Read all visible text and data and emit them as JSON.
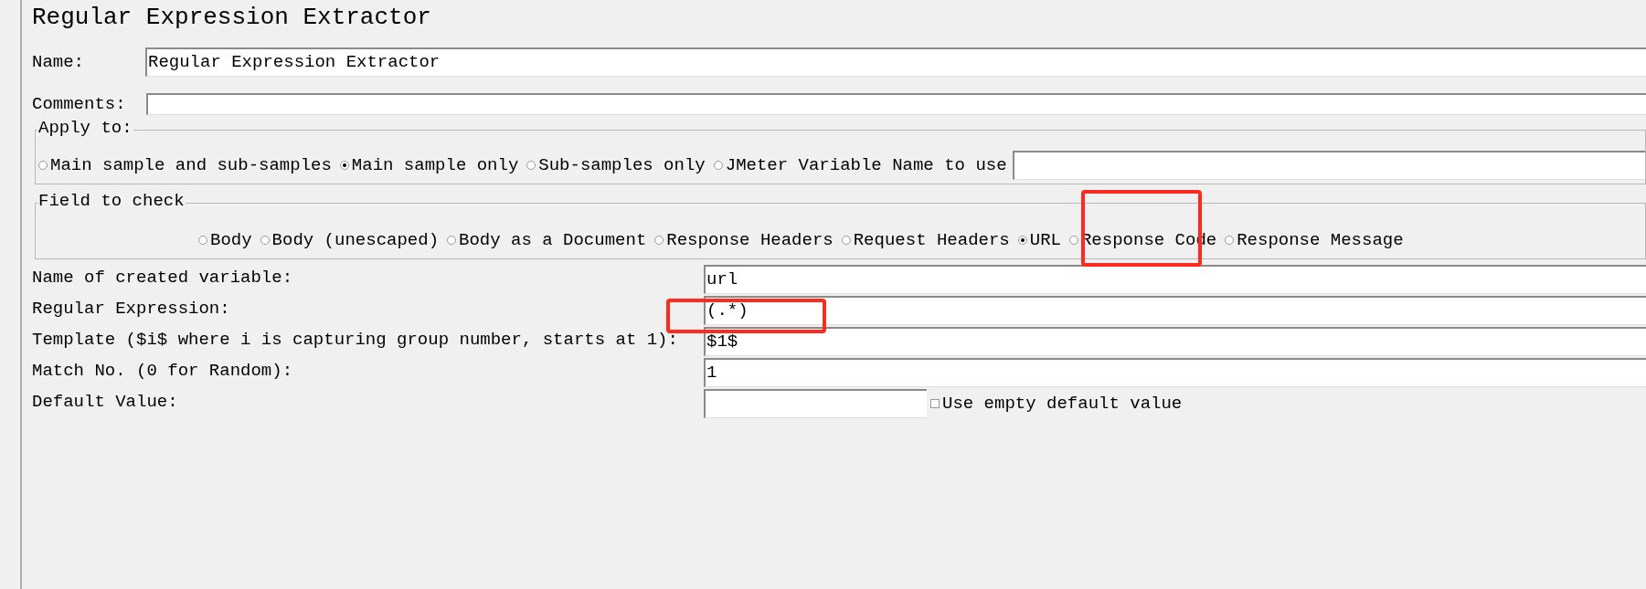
{
  "panel": {
    "title": "Regular Expression Extractor"
  },
  "name": {
    "label": "Name:",
    "value": "Regular Expression Extractor"
  },
  "comments": {
    "label": "Comments:"
  },
  "apply_to": {
    "legend": "Apply to:",
    "options": [
      {
        "label": "Main sample and sub-samples",
        "selected": false
      },
      {
        "label": "Main sample only",
        "selected": true
      },
      {
        "label": "Sub-samples only",
        "selected": false
      },
      {
        "label": "JMeter Variable Name to use",
        "selected": false
      }
    ]
  },
  "field_to_check": {
    "legend": "Field to check",
    "options": [
      {
        "label": "Body",
        "selected": false
      },
      {
        "label": "Body (unescaped)",
        "selected": false
      },
      {
        "label": "Body as a Document",
        "selected": false
      },
      {
        "label": "Response Headers",
        "selected": false
      },
      {
        "label": "Request Headers",
        "selected": false
      },
      {
        "label": "URL",
        "selected": true
      },
      {
        "label": "Response Code",
        "selected": false
      },
      {
        "label": "Response Message",
        "selected": false
      }
    ]
  },
  "parameters": [
    {
      "kind": "wide",
      "label": "Name of created variable:",
      "value": "url"
    },
    {
      "kind": "wide",
      "label": "Regular Expression:",
      "value": "(.*)"
    },
    {
      "kind": "wide",
      "label": "Template ($i$ where i is capturing group number, starts at 1):",
      "value": "$1$"
    },
    {
      "kind": "wide",
      "label": "Match No. (0 for Random):",
      "value": "1"
    },
    {
      "kind": "short",
      "label": "Default Value:",
      "checkbox": {
        "label": "Use empty default value",
        "checked": false
      }
    }
  ]
}
